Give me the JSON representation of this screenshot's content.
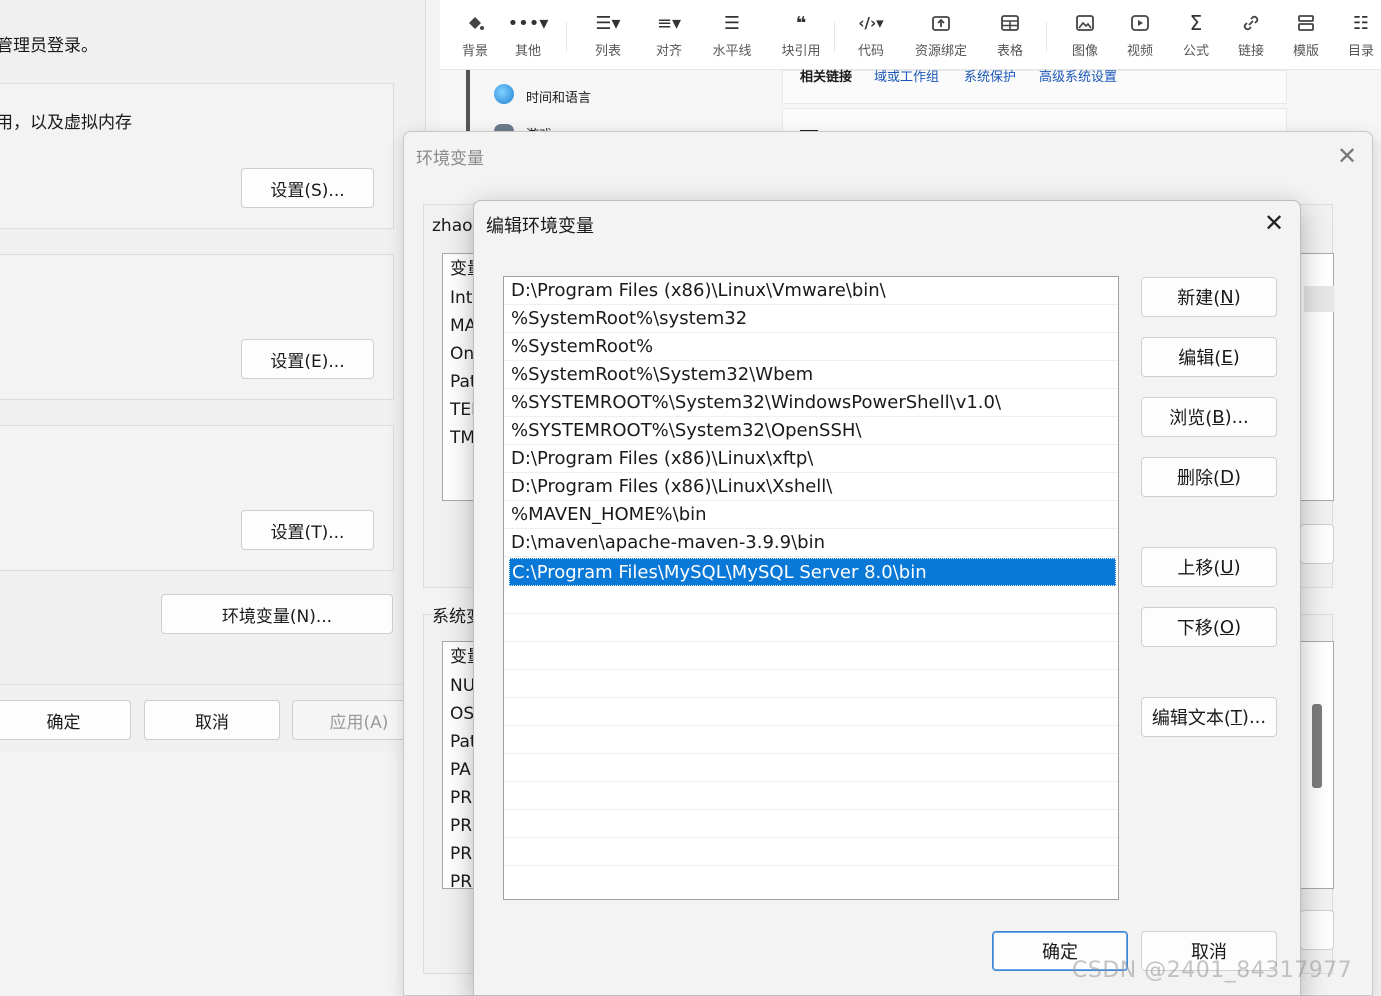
{
  "system_properties": {
    "admin_text": "管理员登录。",
    "memory_text": "用，以及虚拟内存",
    "perf_settings_button": "设置(S)...",
    "profile_settings_button": "设置(E)...",
    "startup_settings_button": "设置(T)...",
    "env_vars_button": "环境变量(N)...",
    "ok_button": "确定",
    "cancel_button": "取消",
    "apply_button": "应用(A)"
  },
  "toolbar": {
    "items": [
      {
        "label": "背景",
        "icon": "background-icon"
      },
      {
        "label": "其他",
        "icon": "more-icon"
      },
      {
        "label": "列表",
        "icon": "list-icon"
      },
      {
        "label": "对齐",
        "icon": "align-icon"
      },
      {
        "label": "水平线",
        "icon": "horizontal-rule-icon"
      },
      {
        "label": "块引用",
        "icon": "blockquote-icon"
      },
      {
        "label": "代码",
        "icon": "code-icon"
      },
      {
        "label": "资源绑定",
        "icon": "resource-bind-icon"
      },
      {
        "label": "表格",
        "icon": "table-icon"
      },
      {
        "label": "图像",
        "icon": "image-icon"
      },
      {
        "label": "视频",
        "icon": "video-icon"
      },
      {
        "label": "公式",
        "icon": "formula-icon"
      },
      {
        "label": "链接",
        "icon": "link-icon"
      },
      {
        "label": "模版",
        "icon": "template-icon"
      },
      {
        "label": "目录",
        "icon": "toc-icon"
      }
    ]
  },
  "settings_page": {
    "nav_time_language": "时间和语言",
    "nav_games": "游戏",
    "related_links": "相关链接",
    "link_domain": "域或工作组",
    "link_protection": "系统保护",
    "link_advanced": "高级系统设置"
  },
  "env_dialog": {
    "title": "环境变量",
    "user_vars_label": "zhao",
    "user_list_header": "变量",
    "user_var_names": [
      "Int",
      "MA",
      "On",
      "Pat",
      "TEI",
      "TM"
    ],
    "system_vars_label": "系统变",
    "system_list_header": "变量",
    "system_var_names": [
      "NU",
      "OS",
      "Pat",
      "PA",
      "PR",
      "PR",
      "PR",
      "PR"
    ]
  },
  "edit_dialog": {
    "title": "编辑环境变量",
    "paths": [
      "D:\\Program Files (x86)\\Linux\\Vmware\\bin\\",
      "%SystemRoot%\\system32",
      "%SystemRoot%",
      "%SystemRoot%\\System32\\Wbem",
      "%SYSTEMROOT%\\System32\\WindowsPowerShell\\v1.0\\",
      "%SYSTEMROOT%\\System32\\OpenSSH\\",
      "D:\\Program Files (x86)\\Linux\\xftp\\",
      "D:\\Program Files (x86)\\Linux\\Xshell\\",
      "%MAVEN_HOME%\\bin",
      "D:\\maven\\apache-maven-3.9.9\\bin",
      "C:\\Program Files\\MySQL\\MySQL Server 8.0\\bin"
    ],
    "selected_index": 10,
    "buttons": {
      "new": {
        "text": "新建(",
        "key": "N",
        "end": ")"
      },
      "edit": {
        "text": "编辑(",
        "key": "E",
        "end": ")"
      },
      "browse": {
        "text": "浏览(",
        "key": "B",
        "end": ")..."
      },
      "delete": {
        "text": "删除(",
        "key": "D",
        "end": ")"
      },
      "move_up": {
        "text": "上移(",
        "key": "U",
        "end": ")"
      },
      "move_down": {
        "text": "下移(",
        "key": "O",
        "end": ")"
      },
      "edit_text": {
        "text": "编辑文本(",
        "key": "T",
        "end": ")..."
      }
    },
    "ok_button": "确定",
    "cancel_button": "取消"
  },
  "watermark": "CSDN @2401_84317977",
  "colors": {
    "selection": "#0a78d7",
    "link": "#1a57b8"
  }
}
